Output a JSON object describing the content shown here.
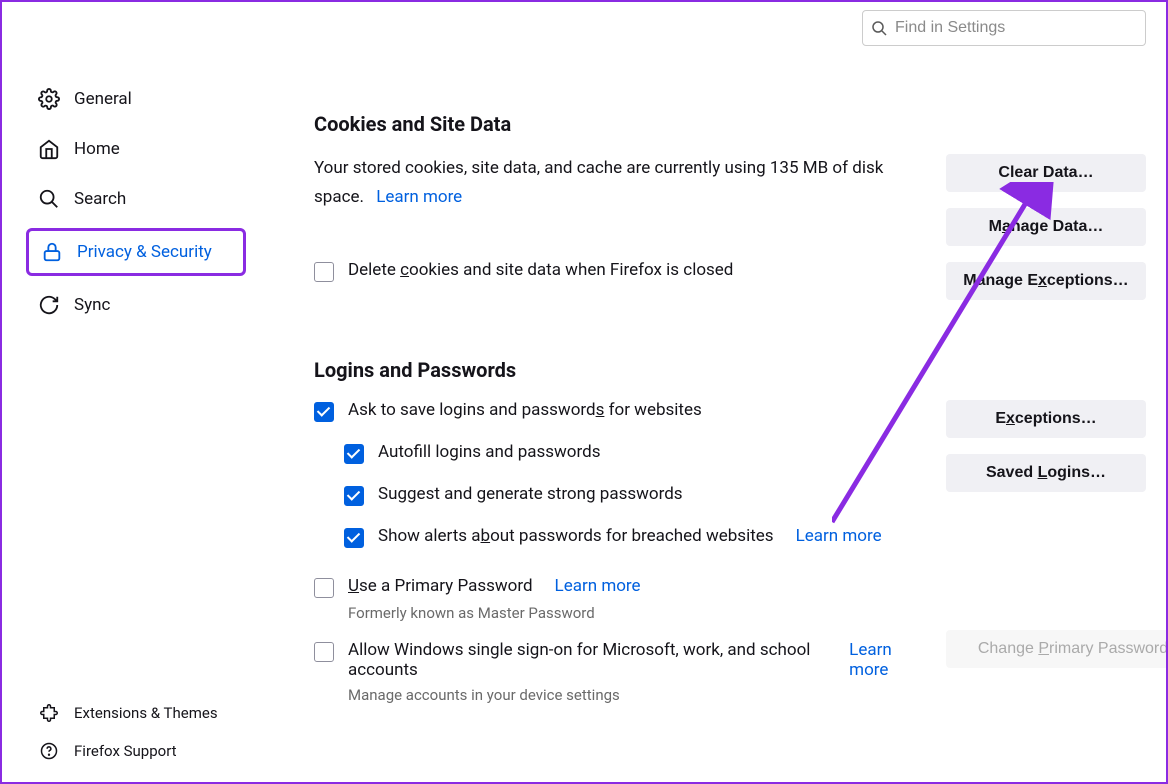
{
  "search": {
    "placeholder": "Find in Settings"
  },
  "sidebar": {
    "items": [
      {
        "label": "General"
      },
      {
        "label": "Home"
      },
      {
        "label": "Search"
      },
      {
        "label": "Privacy & Security"
      },
      {
        "label": "Sync"
      }
    ],
    "footer": [
      {
        "label": "Extensions & Themes"
      },
      {
        "label": "Firefox Support"
      }
    ]
  },
  "cookies": {
    "heading": "Cookies and Site Data",
    "desc": "Your stored cookies, site data, and cache are currently using 135 MB of disk space.",
    "learn": "Learn more",
    "delete_label": "Delete cookies and site data when Firefox is closed",
    "buttons": {
      "clear": "Clear Data…",
      "manage": "Manage Data…",
      "exceptions": "Manage Exceptions…"
    }
  },
  "logins": {
    "heading": "Logins and Passwords",
    "ask": "Ask to save logins and passwords for websites",
    "autofill": "Autofill logins and passwords",
    "suggest": "Suggest and generate strong passwords",
    "alerts": "Show alerts about passwords for breached websites",
    "alerts_learn": "Learn more",
    "use_primary": "Use a Primary Password",
    "use_primary_learn": "Learn more",
    "formerly": "Formerly known as Master Password",
    "allow_sso": "Allow Windows single sign-on for Microsoft, work, and school accounts",
    "allow_sso_learn": "Learn more",
    "manage_accounts": "Manage accounts in your device settings",
    "buttons": {
      "exceptions": "Exceptions…",
      "saved": "Saved Logins…",
      "change_primary": "Change Primary Password…"
    }
  }
}
